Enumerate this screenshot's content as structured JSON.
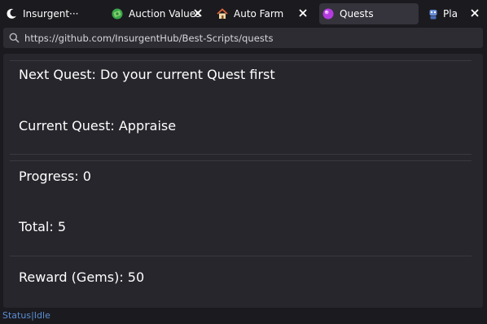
{
  "tabs": [
    {
      "label": "Insurgent···",
      "icon": "moon-icon",
      "active": false
    },
    {
      "label": "Auction Values",
      "icon": "money-icon",
      "active": false
    },
    {
      "label": "Auto Farm",
      "icon": "home-icon",
      "active": false
    },
    {
      "label": "Quests",
      "icon": "gem-icon",
      "active": true
    },
    {
      "label": "Pla",
      "icon": "robot-icon",
      "active": false
    }
  ],
  "address": {
    "url": "https://github.com/InsurgentHub/Best-Scripts/quests"
  },
  "quest": {
    "next": "Next Quest: Do your current Quest first",
    "current": "Current Quest: Appraise",
    "progress": "Progress: 0",
    "total": "Total: 5",
    "reward": "Reward (Gems): 50"
  },
  "status": {
    "label": "Status",
    "separator": "|",
    "value": "Idle"
  },
  "colors": {
    "background": "#1b1a1f",
    "panel": "#27262c",
    "active_tab": "#35333b",
    "status_text": "#5b8fd4"
  }
}
